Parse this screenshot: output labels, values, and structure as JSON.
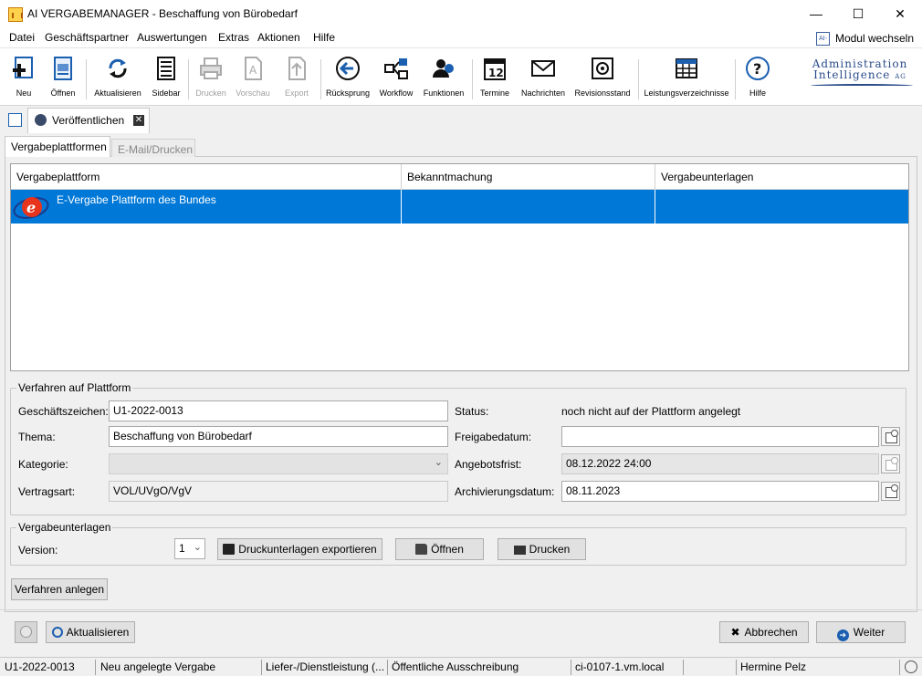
{
  "window": {
    "title": "AI VERGABEMANAGER - Beschaffung von Bürobedarf",
    "controls": {
      "minimize": "—",
      "maximize": "☐",
      "close": "✕"
    }
  },
  "menu": {
    "items": [
      "Datei",
      "Geschäftspartner",
      "Auswertungen",
      "Extras",
      "Aktionen",
      "Hilfe"
    ],
    "modul_wechseln": "Modul wechseln",
    "modul_icon_text": "AI-"
  },
  "toolbar": {
    "buttons": [
      {
        "label": "Neu",
        "icon": "new-icon",
        "enabled": true
      },
      {
        "label": "Öffnen",
        "icon": "open-icon",
        "enabled": true
      },
      {
        "label": "Aktualisieren",
        "icon": "refresh-icon",
        "enabled": true
      },
      {
        "label": "Sidebar",
        "icon": "sidebar-icon",
        "enabled": true
      },
      {
        "label": "Drucken",
        "icon": "print-icon",
        "enabled": false
      },
      {
        "label": "Vorschau",
        "icon": "preview-icon",
        "enabled": false
      },
      {
        "label": "Export",
        "icon": "export-icon",
        "enabled": false
      },
      {
        "label": "Rücksprung",
        "icon": "back-arrow-icon",
        "enabled": true
      },
      {
        "label": "Workflow",
        "icon": "workflow-icon",
        "enabled": true
      },
      {
        "label": "Funktionen",
        "icon": "functions-icon",
        "enabled": true
      },
      {
        "label": "Termine",
        "icon": "calendar-icon",
        "enabled": true
      },
      {
        "label": "Nachrichten",
        "icon": "mail-icon",
        "enabled": true
      },
      {
        "label": "Revisionsstand",
        "icon": "safe-icon",
        "enabled": true
      },
      {
        "label": "Leistungsverzeichnisse",
        "icon": "table-icon",
        "enabled": true
      },
      {
        "label": "Hilfe",
        "icon": "help-icon",
        "enabled": true
      }
    ],
    "calendar_day": "12",
    "brand_line1": "Administration",
    "brand_line2": "Intelligence",
    "brand_suffix": "AG"
  },
  "doc_tab": {
    "label": "Veröffentlichen"
  },
  "inner_tabs": {
    "active": "Vergabeplattformen",
    "inactive": "E-Mail/Drucken"
  },
  "table": {
    "columns": [
      "Vergabeplattform",
      "Bekanntmachung",
      "Vergabeunterlagen"
    ],
    "rows": [
      {
        "plattform": "E-Vergabe Plattform des Bundes",
        "bekanntmachung": "",
        "vergabeunterlagen": "",
        "selected": true
      }
    ]
  },
  "verfahren": {
    "title": "Verfahren auf Plattform",
    "geschaeftszeichen_label": "Geschäftszeichen:",
    "geschaeftszeichen": "U1-2022-0013",
    "thema_label": "Thema:",
    "thema": "Beschaffung von Bürobedarf",
    "kategorie_label": "Kategorie:",
    "kategorie": "",
    "vertragsart_label": "Vertragsart:",
    "vertragsart": "VOL/UVgO/VgV",
    "status_label": "Status:",
    "status": "noch nicht auf der Plattform angelegt",
    "freigabedatum_label": "Freigabedatum:",
    "freigabedatum": "",
    "angebotsfrist_label": "Angebotsfrist:",
    "angebotsfrist": "08.12.2022 24:00",
    "archivierungsdatum_label": "Archivierungsdatum:",
    "archivierungsdatum": "08.11.2023"
  },
  "unterlagen": {
    "title": "Vergabeunterlagen",
    "version_label": "Version:",
    "version": "1",
    "export_label": "Druckunterlagen exportieren",
    "open_label": "Öffnen",
    "print_label": "Drucken"
  },
  "actions": {
    "verfahren_anlegen": "Verfahren anlegen",
    "aktualisieren": "Aktualisieren",
    "abbrechen": "Abbrechen",
    "weiter": "Weiter"
  },
  "statusbar": [
    "U1-2022-0013",
    "Neu angelegte Vergabe",
    "Liefer-/Dienstleistung (...",
    "Öffentliche Ausschreibung",
    "ci-0107-1.vm.local",
    "",
    "Hermine Pelz"
  ],
  "colors": {
    "selection": "#0078d7",
    "brand": "#2b4c8a",
    "accent_blue": "#1b5fb0"
  }
}
